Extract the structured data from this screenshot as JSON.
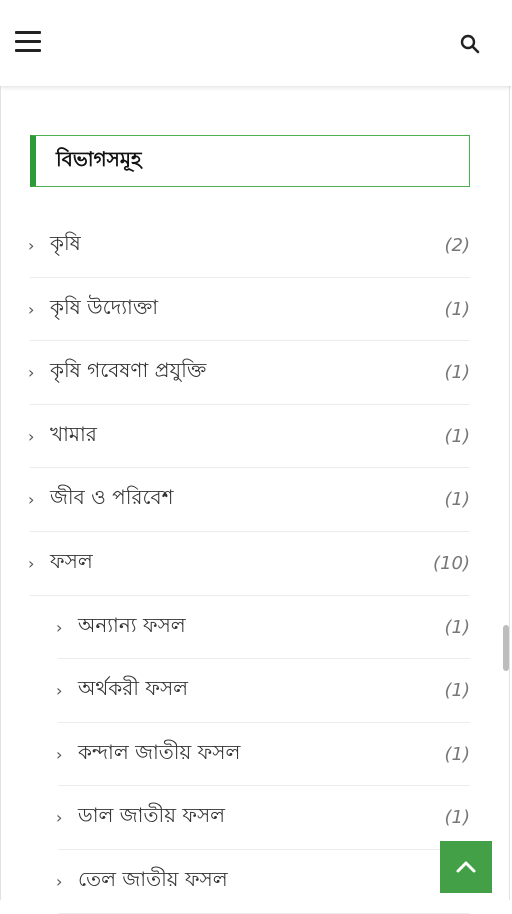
{
  "header": {
    "menu_icon": "hamburger-menu-icon",
    "search_icon": "search-icon"
  },
  "widget": {
    "title": "বিভাগসমূহ"
  },
  "categories": [
    {
      "label": "কৃষি",
      "count": "(2)",
      "level": 0
    },
    {
      "label": "কৃষি উদ্যোক্তা",
      "count": "(1)",
      "level": 0
    },
    {
      "label": "কৃষি গবেষণা প্রযুক্তি",
      "count": "(1)",
      "level": 0
    },
    {
      "label": "খামার",
      "count": "(1)",
      "level": 0
    },
    {
      "label": "জীব ও পরিবেশ",
      "count": "(1)",
      "level": 0
    },
    {
      "label": "ফসল",
      "count": "(10)",
      "level": 0
    },
    {
      "label": "অন্যান্য ফসল",
      "count": "(1)",
      "level": 1
    },
    {
      "label": "অর্থকরী ফসল",
      "count": "(1)",
      "level": 1
    },
    {
      "label": "কন্দাল জাতীয় ফসল",
      "count": "(1)",
      "level": 1
    },
    {
      "label": "ডাল জাতীয় ফসল",
      "count": "(1)",
      "level": 1
    },
    {
      "label": "তেল জাতীয় ফসল",
      "count": "",
      "level": 1
    }
  ],
  "back_to_top_icon": "chevron-up-icon",
  "colors": {
    "accent": "#43a047",
    "title_border": "#2e9b3a"
  }
}
